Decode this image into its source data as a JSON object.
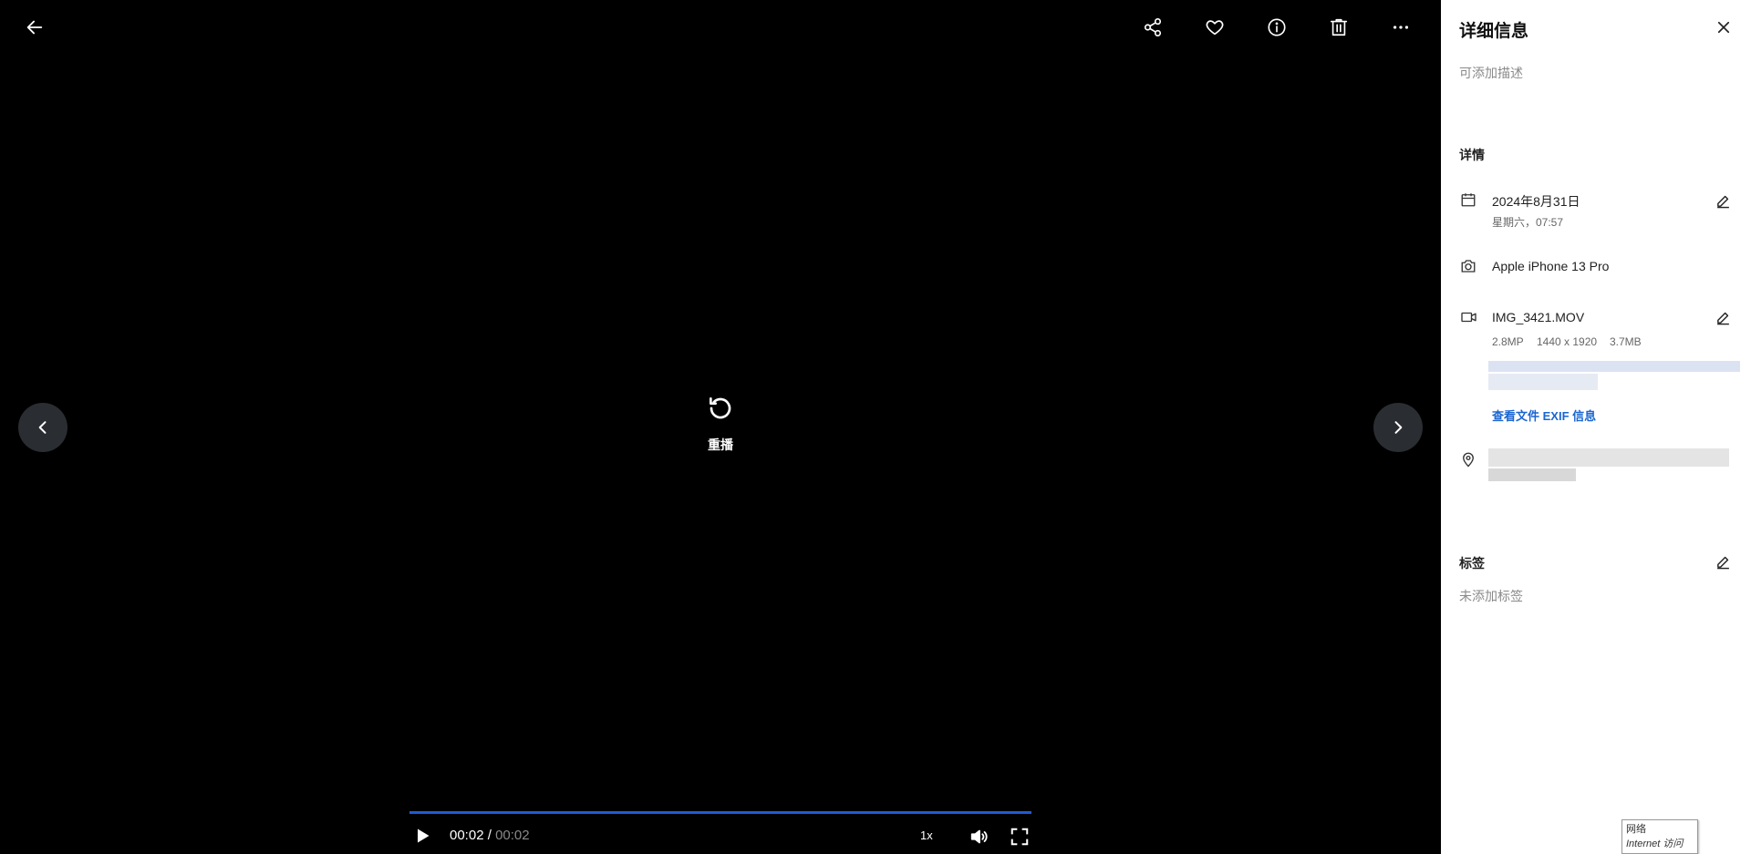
{
  "toolbar": {
    "back_icon": "arrow-left-icon",
    "share_icon": "share-icon",
    "favorite_icon": "heart-icon",
    "info_icon": "info-icon",
    "delete_icon": "trash-icon",
    "more_icon": "more-horizontal-icon"
  },
  "player": {
    "replay_label": "重播",
    "current_time": "00:02",
    "time_separator": " / ",
    "total_time": "00:02",
    "speed": "1x",
    "progress": 1.0,
    "progress_color": "#1e5bd6"
  },
  "panel": {
    "title": "详细信息",
    "description_placeholder": "可添加描述",
    "details_heading": "详情",
    "date": "2024年8月31日",
    "weekday_time": "星期六，07:57",
    "camera": "Apple iPhone 13 Pro",
    "filename": "IMG_3421.MOV",
    "megapixels": "2.8MP",
    "resolution": "1440 x 1920",
    "filesize": "3.7MB",
    "exif_link": "查看文件 EXIF 信息",
    "tags_heading": "标签",
    "tags_empty": "未添加标签",
    "link_color": "#1a66d2"
  },
  "tooltip": {
    "line1": "网络",
    "line2": "Internet 访问"
  }
}
